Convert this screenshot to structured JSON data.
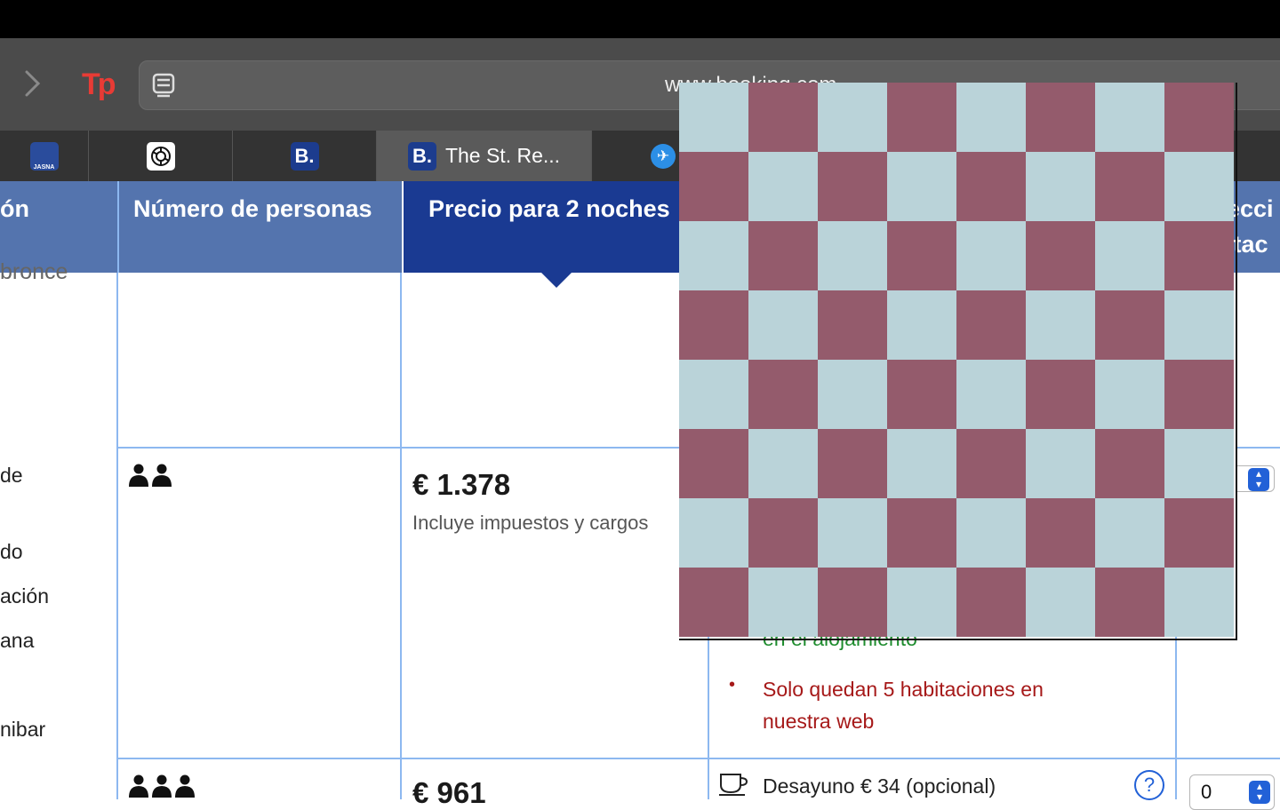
{
  "browser": {
    "url": "www.booking.com",
    "tabs": [
      {
        "favicon": "JASNA",
        "title": ""
      },
      {
        "favicon": "chatgpt-icon",
        "title": ""
      },
      {
        "favicon": "B.",
        "title": ""
      },
      {
        "favicon": "B.",
        "title": "The St. Re..."
      },
      {
        "favicon": "plane-icon",
        "title": ""
      }
    ]
  },
  "table": {
    "headers": {
      "type_partial": "ón",
      "persons": "Número de personas",
      "price": "Precio para 2 noches",
      "select_partial_1": "ecci",
      "select_partial_2": "itac"
    },
    "left_column_fragments": [
      "bronce",
      "de",
      "do",
      "ación",
      "ana",
      "nibar"
    ],
    "rows": [
      {
        "price": "€ 1.378",
        "price_note": "Incluye impuestos y cargos",
        "perks_visible": [
          {
            "text": "en el alojamiento",
            "color": "#1e8c2e"
          },
          {
            "text": "Solo quedan 5 habitaciones en nuestra web",
            "color": "#a61919"
          }
        ]
      },
      {
        "price": "€ 961",
        "breakfast": "Desayuno € 34 (opcional)",
        "select_value": "0"
      }
    ]
  },
  "overlay": {
    "colors": [
      "#bad3d9",
      "#945b6c"
    ]
  }
}
